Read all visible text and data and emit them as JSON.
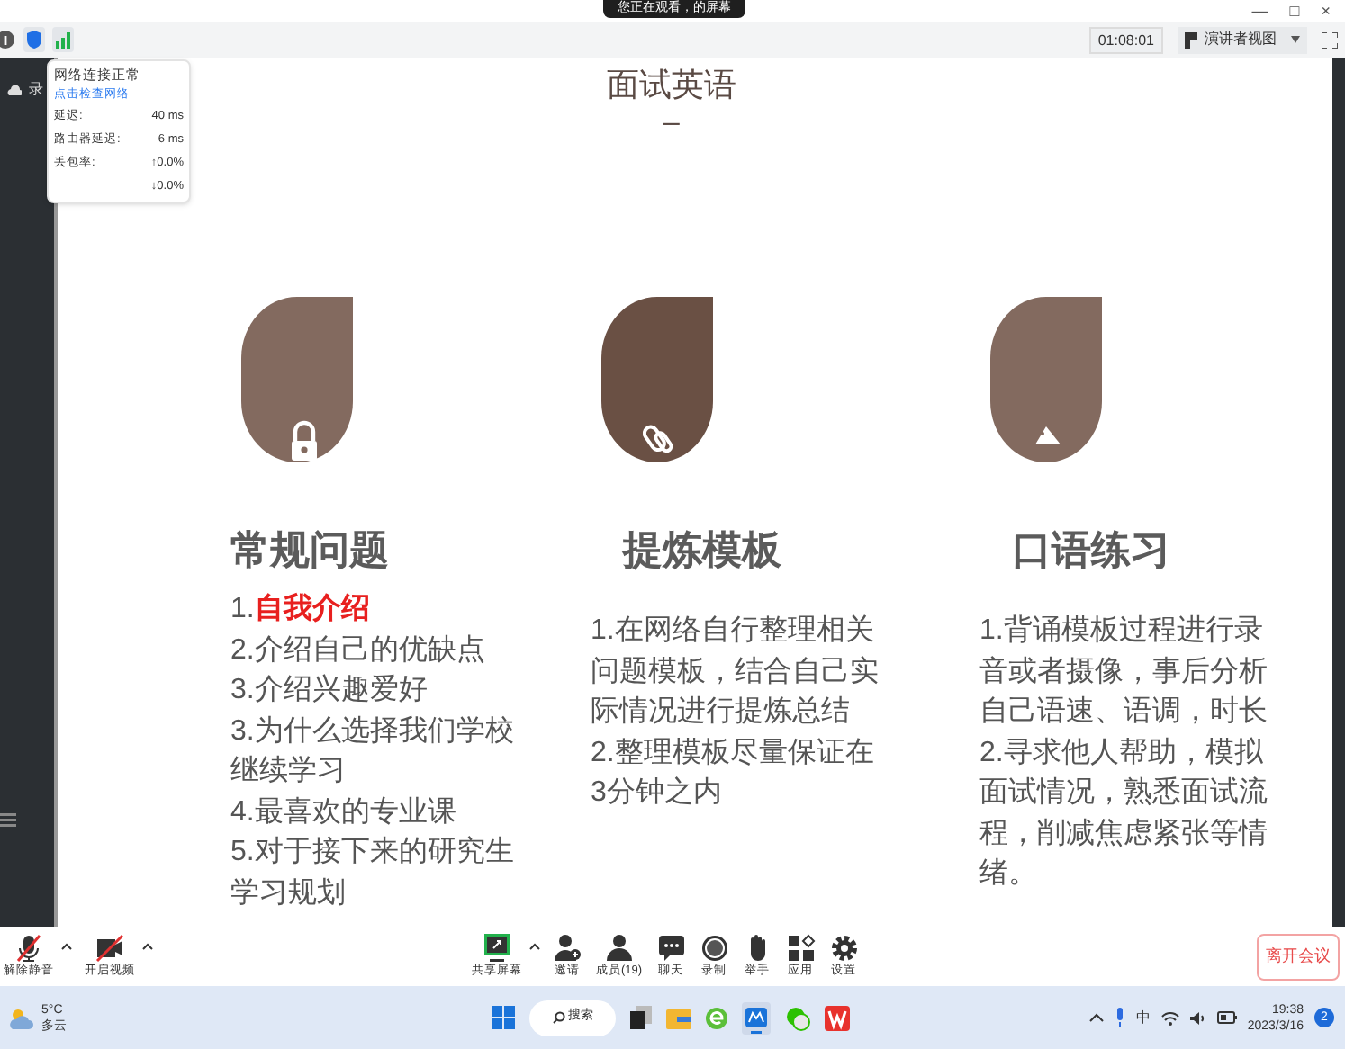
{
  "banner": {
    "text": "您正在观看，的屏幕"
  },
  "window_controls": [
    "—",
    "□",
    "×"
  ],
  "toolbar": {
    "timer": "01:08:01",
    "view_button": "演讲者视图"
  },
  "sidebar": {
    "item": "录"
  },
  "network_popup": {
    "title": "网络连接正常",
    "link": "点击检查网络",
    "rows": [
      {
        "label": "延迟:",
        "value": "40 ms"
      },
      {
        "label": "路由器延迟:",
        "value": "6 ms"
      },
      {
        "label": "丢包率:",
        "value": "↑0.0%"
      },
      {
        "label": "",
        "value": "↓0.0%"
      }
    ]
  },
  "slide": {
    "title": "面试英语",
    "dash": "–",
    "columns": [
      {
        "kind": "lock",
        "heading": "常规问题",
        "items": [
          "1.**自我介绍**",
          "2.介绍自己的优缺点",
          "3.介绍兴趣爱好",
          "3.为什么选择我们学校继续学习",
          "4.最喜欢的专业课",
          "5.对于接下来的研究生学习规划"
        ]
      },
      {
        "kind": "link",
        "heading": "提炼模板",
        "items": [
          "1.在网络自行整理相关问题模板，结合自己实际情况进行提炼总结",
          "2.整理模板尽量保证在3分钟之内"
        ]
      },
      {
        "kind": "tag",
        "heading": "口语练习",
        "items": [
          "1.背诵模板过程进行录音或者摄像，事后分析自己语速、语调，时长",
          "2.寻求他人帮助，模拟面试情况，熟悉面试流程，削减焦虑紧张等情绪。"
        ]
      }
    ]
  },
  "meeting_bar": {
    "left": [
      {
        "kind": "mic",
        "label": "解除静音"
      },
      {
        "kind": "video",
        "label": "开启视频"
      }
    ],
    "center": [
      {
        "kind": "share",
        "label": "共享屏幕"
      },
      {
        "kind": "invite",
        "label": "邀请"
      },
      {
        "kind": "members",
        "label": "成员(19)"
      },
      {
        "kind": "chat",
        "label": "聊天"
      },
      {
        "kind": "record",
        "label": "录制"
      },
      {
        "kind": "hand",
        "label": "举手"
      },
      {
        "kind": "apps",
        "label": "应用"
      },
      {
        "kind": "settings",
        "label": "设置"
      }
    ],
    "leave_button": "离开会议"
  },
  "taskbar": {
    "weather": {
      "temp": "5°C",
      "condition": "多云"
    },
    "search": "搜索",
    "ime": "中",
    "time": "19:38",
    "date": "2023/3/16",
    "notifications": "2"
  }
}
